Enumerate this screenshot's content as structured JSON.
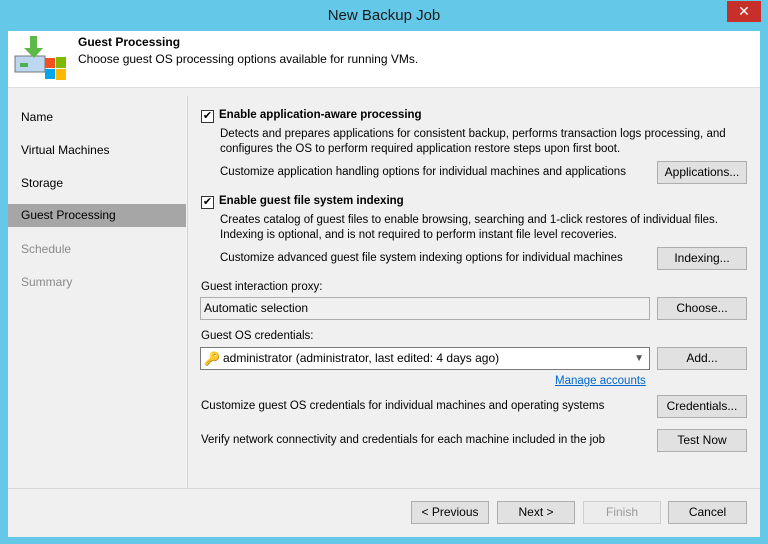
{
  "window": {
    "title": "New Backup Job",
    "close_icon": "close-icon"
  },
  "header": {
    "title": "Guest Processing",
    "subtitle": "Choose guest OS processing options available for running VMs."
  },
  "sidebar": {
    "items": [
      {
        "label": "Name"
      },
      {
        "label": "Virtual Machines"
      },
      {
        "label": "Storage"
      },
      {
        "label": "Guest Processing"
      },
      {
        "label": "Schedule"
      },
      {
        "label": "Summary"
      }
    ]
  },
  "app_aware": {
    "label": "Enable application-aware processing",
    "checked": true,
    "desc1": "Detects and prepares applications for consistent backup, performs transaction logs processing, and",
    "desc2": "configures the OS to perform required application restore steps upon first boot.",
    "customize": "Customize application handling options for individual machines and applications",
    "button": "Applications..."
  },
  "indexing": {
    "label": "Enable guest file system indexing",
    "checked": true,
    "desc1": "Creates catalog of guest files to enable browsing, searching and 1-click restores of individual files.",
    "desc2": "Indexing is optional, and is not required to perform instant file level recoveries.",
    "customize": "Customize advanced guest file system indexing options for individual machines",
    "button": "Indexing..."
  },
  "proxy": {
    "label": "Guest interaction proxy:",
    "value": "Automatic selection",
    "button": "Choose..."
  },
  "credentials": {
    "label": "Guest OS credentials:",
    "value": "administrator (administrator, last edited: 4 days ago)",
    "button": "Add...",
    "link": "Manage accounts",
    "customize": "Customize guest OS credentials for individual machines and operating systems",
    "customize_button": "Credentials...",
    "verify": "Verify network connectivity and credentials for each machine included in the job",
    "verify_button": "Test Now"
  },
  "footer": {
    "previous": "< Previous",
    "next": "Next >",
    "finish": "Finish",
    "cancel": "Cancel"
  }
}
